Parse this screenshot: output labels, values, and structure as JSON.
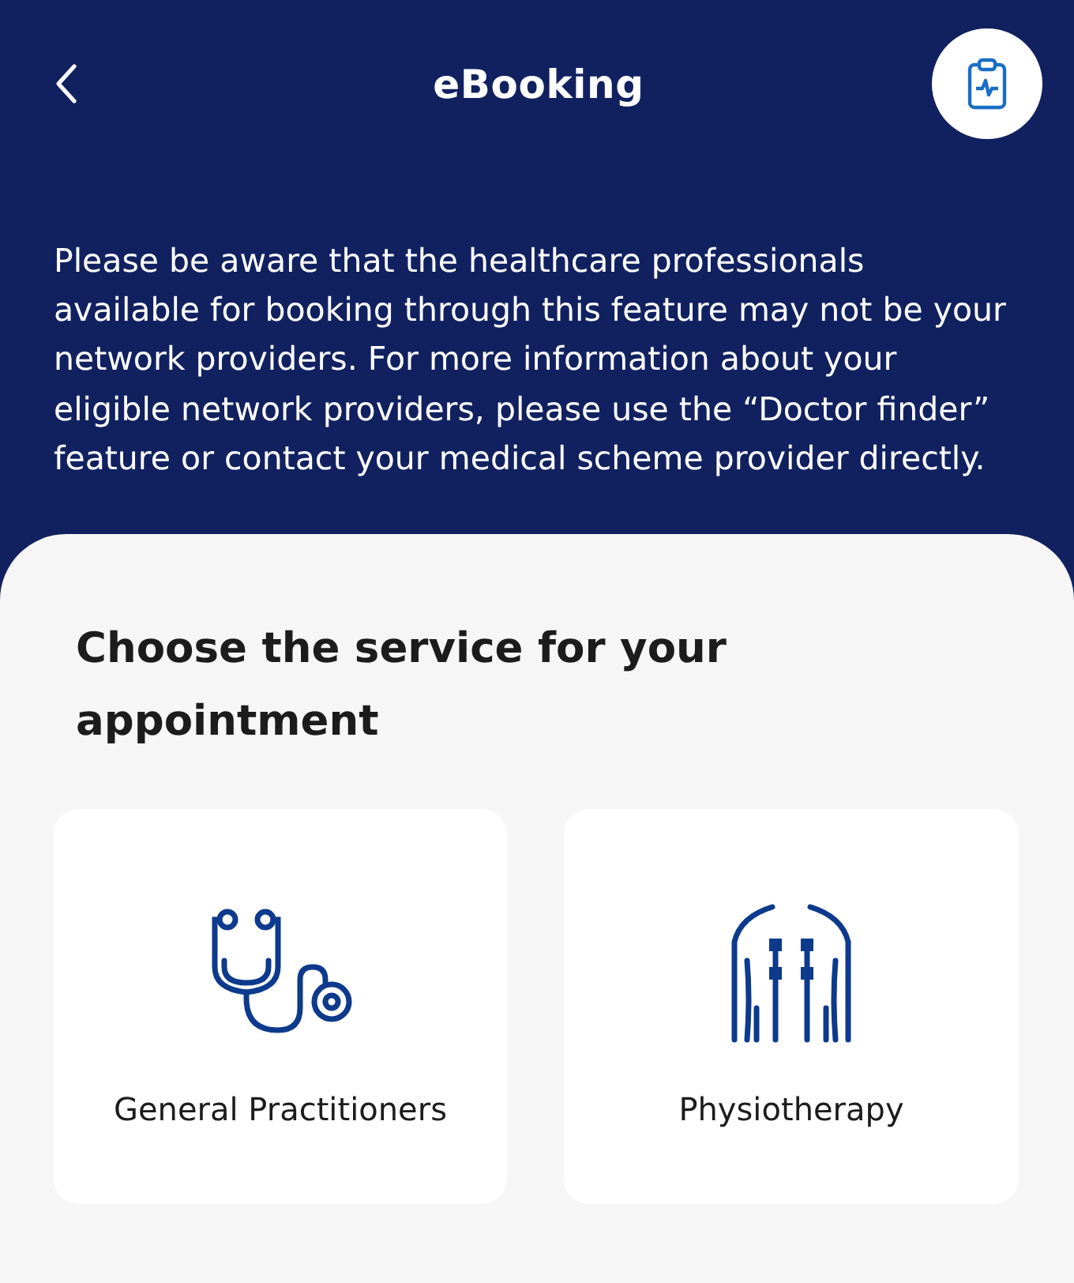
{
  "header": {
    "title": "eBooking"
  },
  "notice": "Please be aware that the healthcare professionals available for booking through this feature may not be your network providers. For more information about your eligible network providers, please use the “Doctor finder” feature or contact your medical scheme provider directly.",
  "section": {
    "heading": "Choose the service for your appointment"
  },
  "services": [
    {
      "kind": "stethoscope",
      "label": "General Practitioners"
    },
    {
      "kind": "physio",
      "label": "Physiotherapy"
    }
  ]
}
